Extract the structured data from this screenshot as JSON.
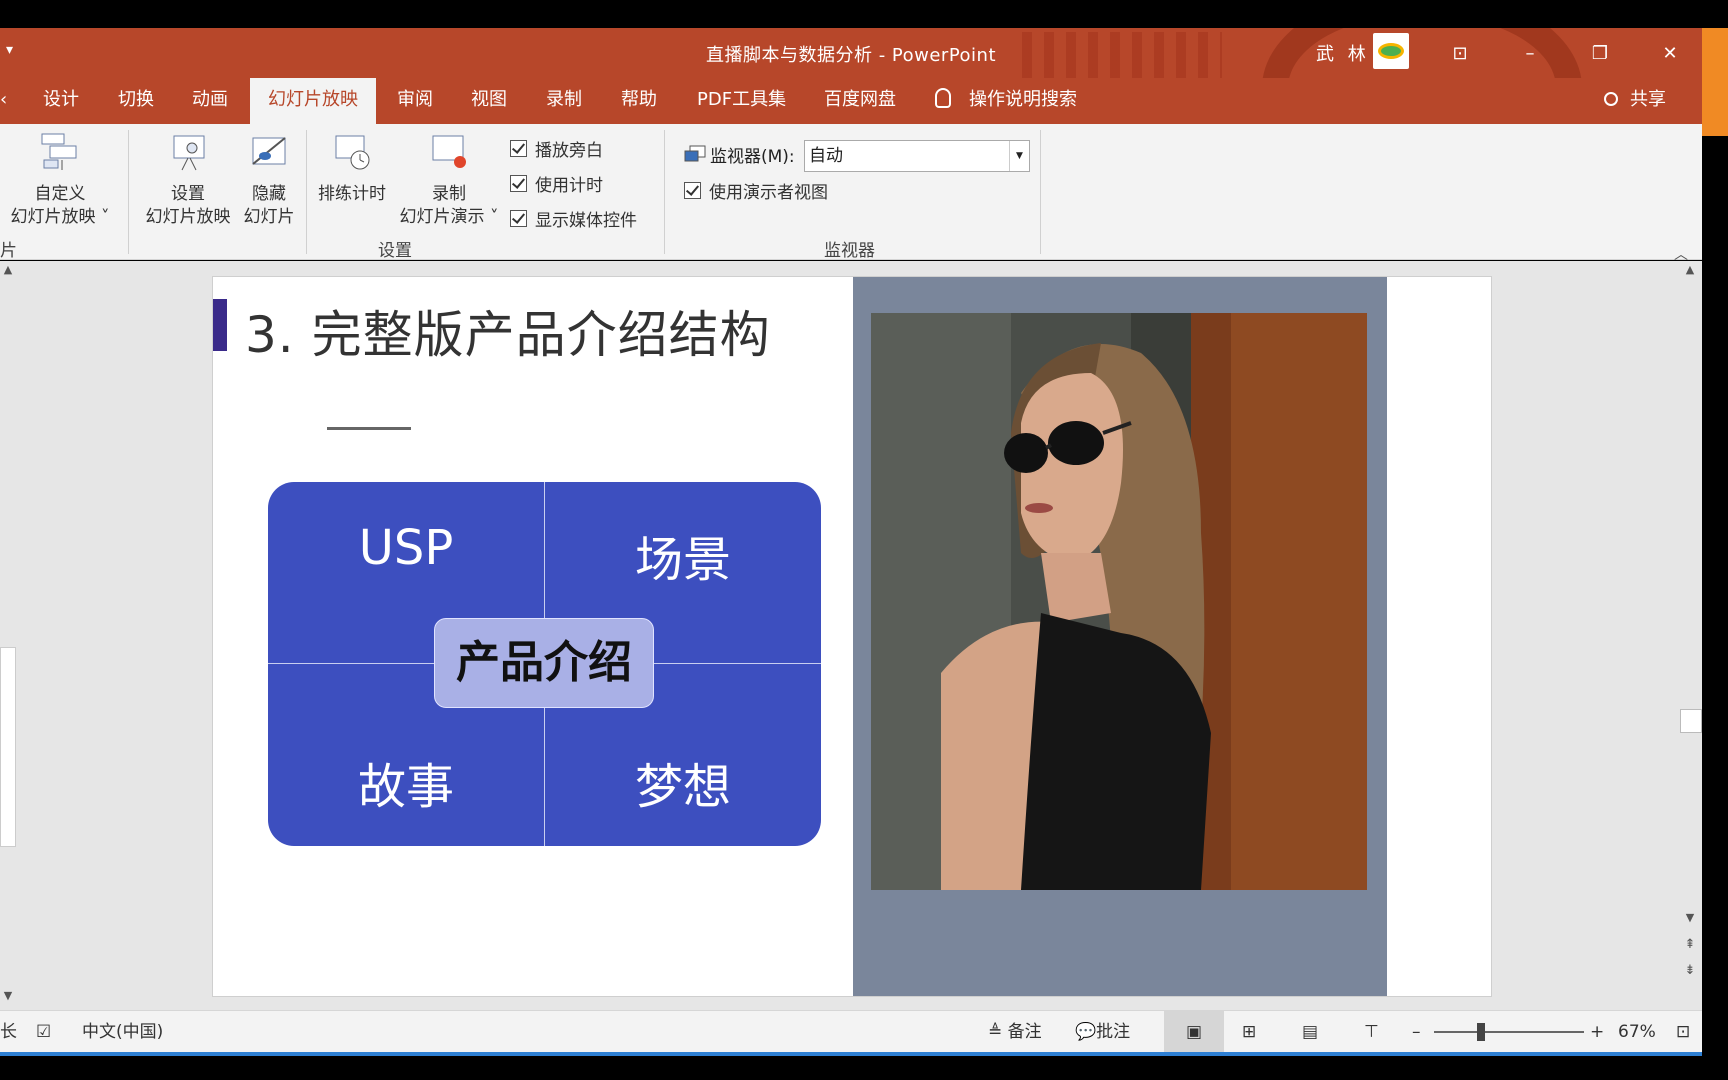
{
  "titlebar": {
    "doc_title": "直播脚本与数据分析  -  PowerPoint",
    "user_name": "武 林",
    "minimize": "–",
    "restore": "❐",
    "close": "✕",
    "ribbon_options": "⊡"
  },
  "tabs": [
    "设计",
    "切换",
    "动画",
    "幻灯片放映",
    "审阅",
    "视图",
    "录制",
    "帮助",
    "PDF工具集",
    "百度网盘"
  ],
  "active_tab": "幻灯片放映",
  "tell_me": "操作说明搜索",
  "share": "共享",
  "ribbon": {
    "custom_show": {
      "line1": "自定义",
      "line2": "幻灯片放映 ˅"
    },
    "group1_label_partial": "片",
    "setup_show": {
      "line1": "设置",
      "line2": "幻灯片放映"
    },
    "hide_slide": {
      "line1": "隐藏",
      "line2": "幻灯片"
    },
    "rehearse": {
      "line1": "排练计时"
    },
    "record": {
      "line1": "录制",
      "line2": "幻灯片演示 ˅"
    },
    "play_narrations": "播放旁白",
    "use_timings": "使用计时",
    "show_media_controls": "显示媒体控件",
    "setup_group_label": "设置",
    "monitor_label": "监视器(M):",
    "monitor_value": "自动",
    "presenter_view": "使用演示者视图",
    "monitors_group_label": "监视器"
  },
  "slide": {
    "title": "3. 完整版产品介绍结构",
    "cells": {
      "top_left": "USP",
      "top_right": "场景",
      "bottom_left": "故事",
      "bottom_right": "梦想"
    },
    "center": "产品介绍"
  },
  "statusbar": {
    "slide_partial": "长",
    "language": "中文(中国)",
    "notes": "备注",
    "comments": "批注",
    "zoom_minus": "–",
    "zoom_plus": "+",
    "zoom": "67%"
  },
  "colors": {
    "accent": "#b7472a",
    "grid_blue": "#3d4fbf",
    "center_box": "#a9b0e6",
    "photo_panel": "#7a869b"
  }
}
